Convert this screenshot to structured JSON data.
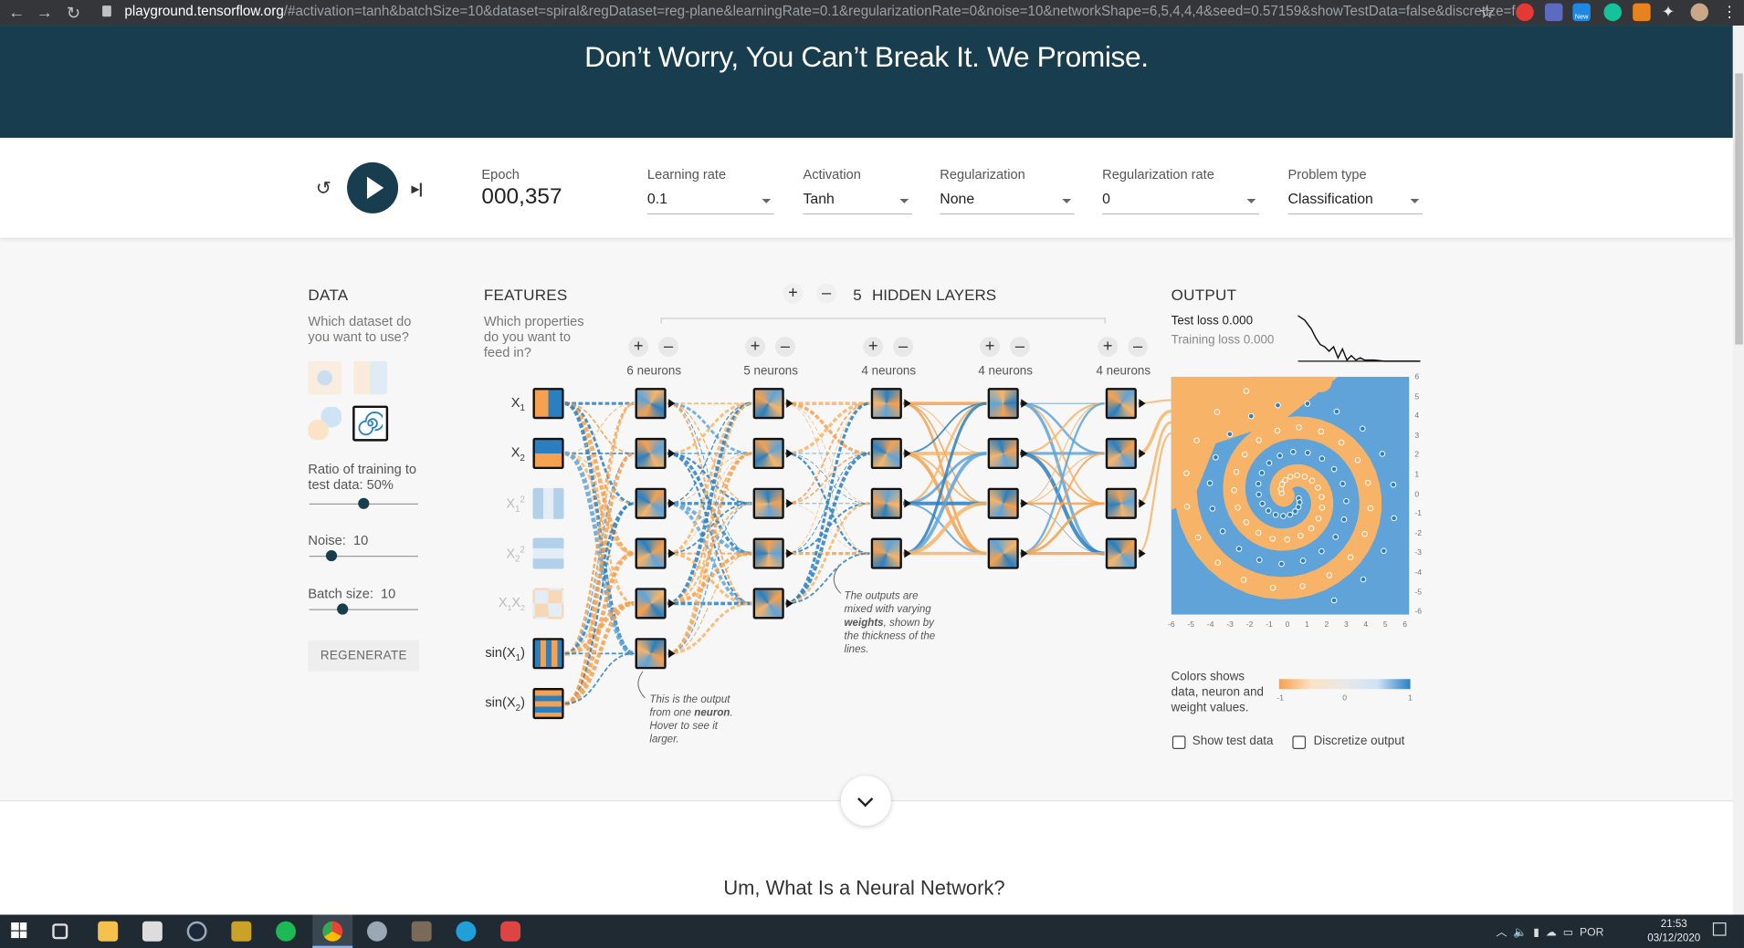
{
  "browser": {
    "url_host": "playground.tensorflow.org",
    "url_rest": "/#activation=tanh&batchSize=10&dataset=spiral&regDataset=reg-plane&learningRate=0.1&regularizationRate=0&noise=10&networkShape=6,5,4,4,4&seed=0.57159&showTestData=false&discretize=false&p...",
    "ext_badge": "New"
  },
  "hero": {
    "text": "Don’t Worry, You Can’t Break It. We Promise."
  },
  "controls": {
    "epoch_label": "Epoch",
    "epoch_value": "000,357",
    "learning_rate": {
      "label": "Learning rate",
      "value": "0.1"
    },
    "activation": {
      "label": "Activation",
      "value": "Tanh"
    },
    "regularization": {
      "label": "Regularization",
      "value": "None"
    },
    "regularization_rate": {
      "label": "Regularization rate",
      "value": "0"
    },
    "problem_type": {
      "label": "Problem type",
      "value": "Classification"
    }
  },
  "data_panel": {
    "title": "DATA",
    "subtitle": "Which dataset do you want to use?",
    "ratio_label": "Ratio of training to test data:",
    "ratio_value": "50%",
    "ratio_fraction": 0.5,
    "noise_label": "Noise:",
    "noise_value": "10",
    "noise_fraction": 0.2,
    "batch_label": "Batch size:",
    "batch_value": "10",
    "batch_fraction": 0.31,
    "regenerate": "REGENERATE"
  },
  "features": {
    "title": "FEATURES",
    "subtitle": "Which properties do you want to feed in?"
  },
  "hidden_layers": {
    "count": "5",
    "label": "HIDDEN LAYERS",
    "plus": "+",
    "minus": "–",
    "neuron_counts": [
      "6 neurons",
      "5 neurons",
      "4 neurons",
      "4 neurons",
      "4 neurons"
    ],
    "note_neuron_1": "This is the output",
    "note_neuron_2": "from one",
    "note_neuron_bold": "neuron",
    "note_neuron_3": ". Hover to see it larger.",
    "note_weights_1": "The outputs are mixed with varying",
    "note_weights_bold": "weights",
    "note_weights_2": ", shown by the thickness of the lines."
  },
  "output": {
    "title": "OUTPUT",
    "test_loss": "Test loss 0.000",
    "training_loss": "Training loss 0.000",
    "y_ticks": [
      "6",
      "5",
      "4",
      "3",
      "2",
      "1",
      "0",
      "-1",
      "-2",
      "-3",
      "-4",
      "-5",
      "-6"
    ],
    "x_ticks": [
      "-6",
      "-5",
      "-4",
      "-3",
      "-2",
      "-1",
      "0",
      "1",
      "2",
      "3",
      "4",
      "5",
      "6"
    ],
    "colors_note": "Colors shows data, neuron and weight values.",
    "scale_ticks": [
      "-1",
      "0",
      "1"
    ],
    "show_test_data": "Show test data",
    "discretize_output": "Discretize output"
  },
  "colors": {
    "orange": "#f5a150",
    "blue": "#2a7fc1",
    "light_blue": "#5fa3d9",
    "light_orange": "#f7b469",
    "dark_navy": "#183d4e"
  },
  "section": {
    "title": "Um, What Is a Neural Network?"
  },
  "taskbar": {
    "lang": "POR",
    "time": "21:53",
    "date": "03/12/2020"
  }
}
